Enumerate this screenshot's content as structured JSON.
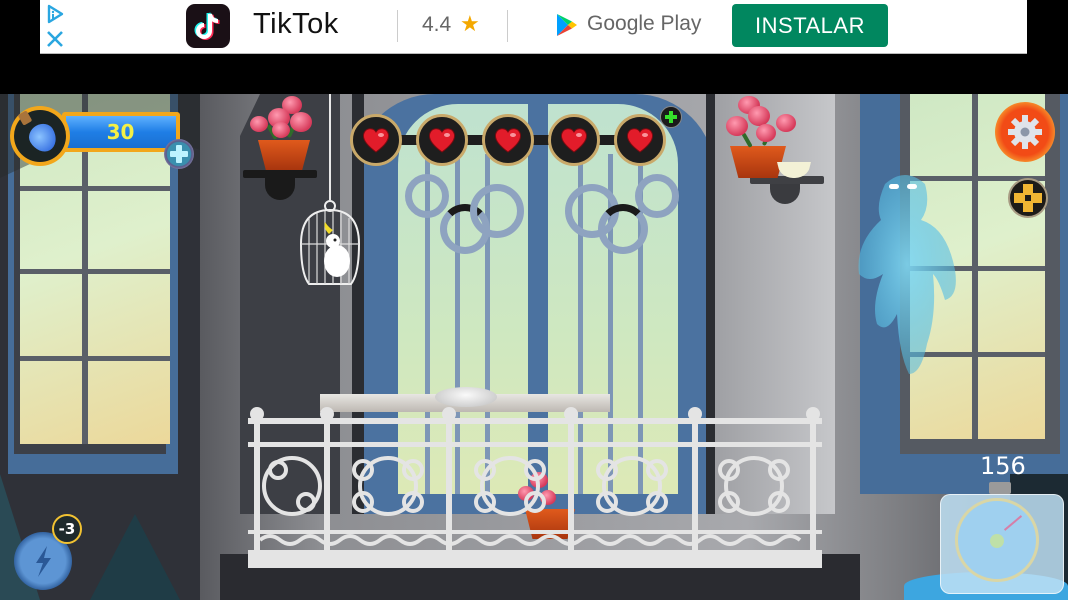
{
  "ad": {
    "adchoices_icon": "adchoices-triangle-icon",
    "close_icon": "close-x-icon",
    "app_icon": "tiktok-logo-icon",
    "app_name": "TikTok",
    "rating": "4.4",
    "rating_icon": "star-icon",
    "store_icon": "google-play-icon",
    "store_name": "Google Play",
    "install_label": "INSTALAR",
    "colors": {
      "install_bg": "#01875f",
      "star": "#f4a800"
    }
  },
  "hud": {
    "potion": {
      "icon": "potion-bottle-icon",
      "value": "30",
      "add_icon": "plus-icon"
    },
    "lives": {
      "count": 5,
      "max": 5,
      "heart_icon": "heart-icon",
      "add_icon": "green-plus-icon"
    },
    "settings_icon": "gear-icon",
    "move_icon": "dpad-arrows-icon",
    "power": {
      "icon": "lightning-icon",
      "badge": "-3"
    },
    "timer": {
      "value": "156",
      "icon": "frozen-stopwatch-icon"
    },
    "colors": {
      "potion_bar": "#1f7ee6",
      "potion_text": "#f4f046",
      "gold_ring": "#f2a71b",
      "heart": "#e21c2a",
      "settings_ring": "#f24b16"
    }
  },
  "scene": {
    "objects": [
      "left-window",
      "center-door",
      "right-window",
      "birdcage-with-cockatoo",
      "flower-pot-left",
      "flower-pot-right",
      "bowl",
      "balcony-railing",
      "ghost",
      "flower-pot-balcony"
    ]
  }
}
